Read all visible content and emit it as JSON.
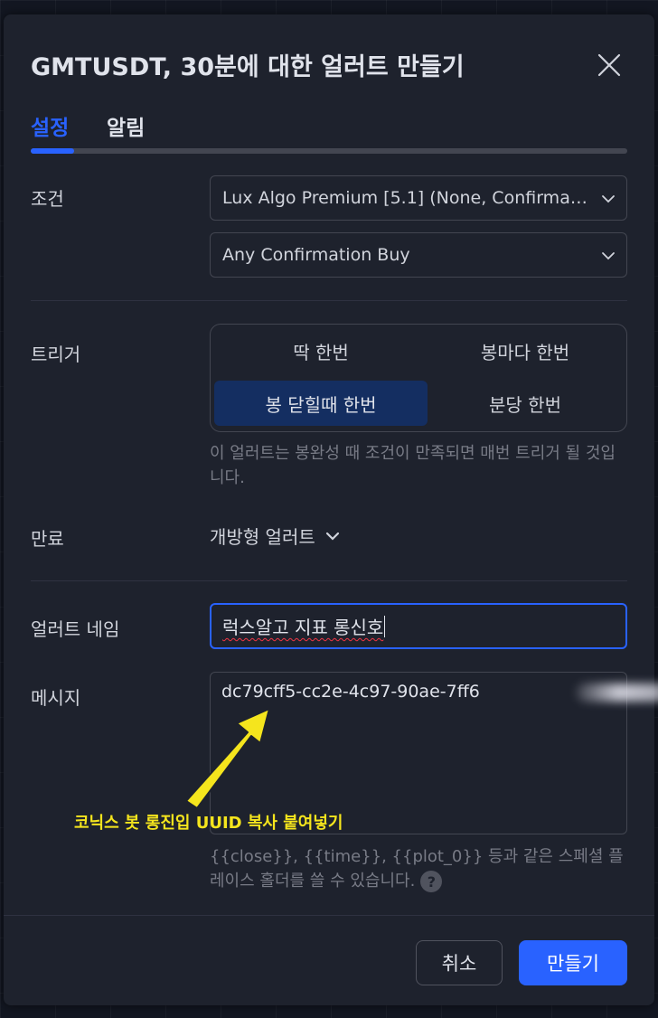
{
  "dialog": {
    "title": "GMTUSDT, 30분에 대한 얼러트 만들기",
    "close_icon": "close-icon"
  },
  "tabs": [
    {
      "label": "설정",
      "active": true
    },
    {
      "label": "알림",
      "active": false
    }
  ],
  "condition": {
    "label": "조건",
    "indicator": "Lux Algo Premium [5.1] (None, Confirmat...",
    "signal": "Any Confirmation Buy"
  },
  "trigger": {
    "label": "트리거",
    "options": [
      "딱 한번",
      "봉마다 한번",
      "봉 닫힐때 한번",
      "분당 한번"
    ],
    "selected": "봉 닫힐때 한번",
    "hint": "이 얼러트는 봉완성 때 조건이 만족되면 매번 트리거 될 것입니다."
  },
  "expiration": {
    "label": "만료",
    "value": "개방형 얼러트"
  },
  "alert_name": {
    "label": "얼러트 네임",
    "value": "럭스알고 지표 롱신호"
  },
  "message": {
    "label": "메시지",
    "value": "dc79cff5-cc2e-4c97-90ae-7ff6",
    "hint": "{{close}}, {{time}}, {{plot_0}} 등과 같은 스페셜 플레이스 홀더를 쓸 수 있습니다.",
    "annotation": "코닉스 봇 롱진입 UUID 복사 붙여넣기"
  },
  "footer": {
    "cancel_label": "취소",
    "create_label": "만들기"
  },
  "colors": {
    "accent": "#2962ff",
    "background": "#1e222d",
    "annotation": "#f5e51d"
  }
}
